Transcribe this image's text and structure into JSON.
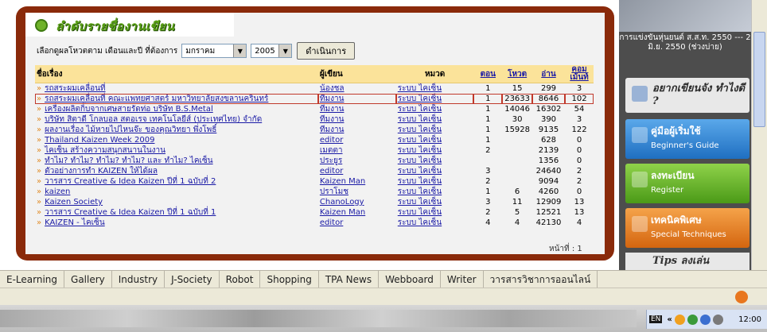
{
  "panel": {
    "title": "ลำดับรายชื่องานเขียน",
    "filter_label": "เลือกดูผลโหวตตาม  เดือนและปี  ที่ต้องการ",
    "month_value": "มกราคม",
    "year_value": "2005",
    "go_button": "ดำเนินการ"
  },
  "table": {
    "headers": {
      "title": "ชื่อเรื่อง",
      "author": "ผู้เขียน",
      "category": "หมวด",
      "chapters": "ตอน",
      "votes": "โหวต",
      "reads": "อ่าน",
      "comments": "คอมเม้นท์"
    },
    "rows": [
      {
        "title": "รถสระผมเคลื่อนที่",
        "author": "น้องชล",
        "category": "ระบบ ไคเซ็น",
        "chapters": "1",
        "votes": "15",
        "reads": "299",
        "comments": "3"
      },
      {
        "title": "รถสระผมเคลื่อนที่ คณะแพทยศาสตร์ มหาวิทยาลัยสงขลานครินทร์",
        "author": "ทีมงาน",
        "category": "ระบบ ไคเซ็น",
        "chapters": "1",
        "votes": "23633",
        "reads": "8646",
        "comments": "102"
      },
      {
        "title": "เครื่องผลิตกิ้บจากเศษสายรัดท่อ บริษัท B.S.Metal",
        "author": "ทีมงาน",
        "category": "ระบบ ไคเซ็น",
        "chapters": "1",
        "votes": "14046",
        "reads": "16302",
        "comments": "54"
      },
      {
        "title": "บริษัท สิตาดี โกลบอล สตอเรจ เทคโนโลยีส์ (ประเทศไทย) จำกัด",
        "author": "ทีมงาน",
        "category": "ระบบ ไคเซ็น",
        "chapters": "1",
        "votes": "30",
        "reads": "390",
        "comments": "3"
      },
      {
        "title": "ผลงานเรื่อง ไม้หายไปไหนจ๊ะ ของคุณวิทยา พึ่งโพธิ์",
        "author": "ทีมงาน",
        "category": "ระบบ ไคเซ็น",
        "chapters": "1",
        "votes": "15928",
        "reads": "9135",
        "comments": "122"
      },
      {
        "title": "Thailand Kaizen Week 2009",
        "author": "editor",
        "category": "ระบบ ไคเซ็น",
        "chapters": "1",
        "votes": "",
        "reads": "628",
        "comments": "0"
      },
      {
        "title": "ไคเซ็น สร้างความสนุกสนานในงาน",
        "author": "เมตตา",
        "category": "ระบบ ไคเซ็น",
        "chapters": "2",
        "votes": "",
        "reads": "2139",
        "comments": "0"
      },
      {
        "title": "ทำไม? ทำไม? ทำไม? ทำไม? และ ทำไม? ไคเซ็น",
        "author": "ประยูร",
        "category": "ระบบ ไคเซ็น",
        "chapters": "",
        "votes": "",
        "reads": "1356",
        "comments": "0"
      },
      {
        "title": "ตัวอย่างการทำ KAIZEN ให้ได้ผล",
        "author": "editor",
        "category": "ระบบ ไคเซ็น",
        "chapters": "3",
        "votes": "",
        "reads": "24640",
        "comments": "2"
      },
      {
        "title": "วารสาร Creative & Idea Kaizen ปีที่ 1 ฉบับที่ 2",
        "author": "Kaizen Man",
        "category": "ระบบ ไคเซ็น",
        "chapters": "2",
        "votes": "",
        "reads": "9094",
        "comments": "2"
      },
      {
        "title": "kaizen",
        "author": "ปราโมช",
        "category": "ระบบ ไคเซ็น",
        "chapters": "1",
        "votes": "6",
        "reads": "4260",
        "comments": "0"
      },
      {
        "title": "Kaizen Society",
        "author": "ChanoLogy",
        "category": "ระบบ ไคเซ็น",
        "chapters": "3",
        "votes": "11",
        "reads": "12909",
        "comments": "13"
      },
      {
        "title": "วารสาร Creative & Idea Kaizen ปีที่ 1 ฉบับที่ 1",
        "author": "Kaizen Man",
        "category": "ระบบ ไคเซ็น",
        "chapters": "2",
        "votes": "5",
        "reads": "12521",
        "comments": "13"
      },
      {
        "title": "KAIZEN - ไคเซ็น",
        "author": "editor",
        "category": "ระบบ ไคเซ็น",
        "chapters": "4",
        "votes": "4",
        "reads": "42130",
        "comments": "4"
      }
    ],
    "pages": "หน้าที่ :  1"
  },
  "sidebar": {
    "photo_caption": "การแข่งขันหุ่นยนต์ ส.ส.ท. 2550 --- 2 มิ.ย. 2550 (ช่วงบ่าย)",
    "writer_banner": "อยากเขียนจัง ทำไงดี ?",
    "beginner_th": "คู่มือผู้เริ่มใช้",
    "beginner_en": "Beginner's Guide",
    "register_th": "ลงทะเบียน",
    "register_en": "Register",
    "special_th": "เทคนิคพิเศษ",
    "special_en": "Special Techniques",
    "tips": "Tips ลงเล่น"
  },
  "bookmarks": [
    "E-Learning",
    "Gallery",
    "Industry",
    "J-Society",
    "Robot",
    "Shopping",
    "TPA News",
    "Webboard",
    "Writer",
    "วารสารวิชาการออนไลน์"
  ],
  "tray": {
    "lang": "EN",
    "clock": "12:00"
  }
}
